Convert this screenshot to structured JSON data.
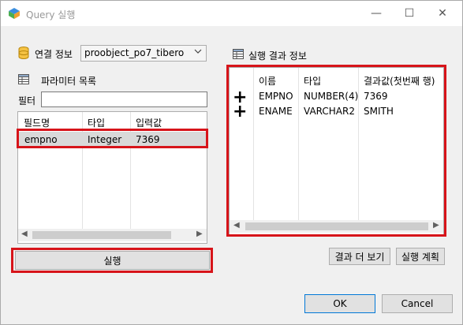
{
  "window": {
    "title": "Query 실행",
    "controls": {
      "minimize": "—",
      "maximize": "☐",
      "close": "✕"
    }
  },
  "connection": {
    "label": "연결 정보",
    "selected": "proobject_po7_tibero"
  },
  "params": {
    "label": "파라미터 목록",
    "filter_label": "필터",
    "filter_value": "",
    "columns": [
      "필드명",
      "타입",
      "입력값"
    ],
    "rows": [
      {
        "field": "empno",
        "type": "Integer",
        "value": "7369"
      }
    ]
  },
  "result": {
    "label": "실행 결과 정보",
    "columns": [
      "이름",
      "타입",
      "결과값(첫번째 행)"
    ],
    "rows": [
      {
        "name": "EMPNO",
        "type": "NUMBER(4)",
        "value": "7369"
      },
      {
        "name": "ENAME",
        "type": "VARCHAR2",
        "value": "SMITH"
      }
    ]
  },
  "buttons": {
    "execute": "실행",
    "more_results": "결과 더 보기",
    "exec_plan": "실행 계획",
    "ok": "OK",
    "cancel": "Cancel"
  },
  "colors": {
    "highlight": "#d7141a",
    "selection": "#d9d9d9",
    "accent": "#0078d7"
  },
  "icons": [
    "app-icon",
    "database-icon",
    "table-icon",
    "expand-plus-icon"
  ]
}
